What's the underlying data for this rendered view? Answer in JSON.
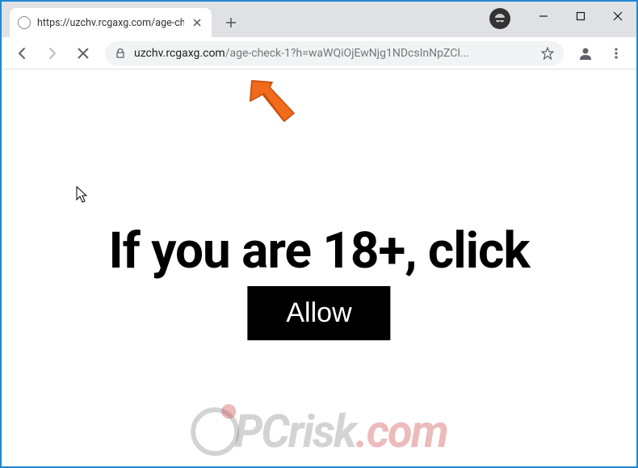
{
  "window": {
    "tab_title": "https://uzchv.rcgaxg.com/age-che",
    "url_domain": "uzchv.rcgaxg.com",
    "url_path": "/age-check-1?h=waWQiOjEwNjg1NDcsInNpZCI...",
    "colors": {
      "accent": "#1e88d4",
      "titlebar": "#dfe1e5",
      "arrow": "#f26a1b"
    }
  },
  "page": {
    "headline": "If you are 18+, click",
    "allow_label": "Allow"
  },
  "watermark": {
    "brand": "PCrisk",
    "tld": ".com"
  },
  "icons": {
    "back": "back-icon",
    "forward": "forward-icon",
    "stop": "stop-icon",
    "lock": "lock-icon",
    "star": "star-icon",
    "profile": "profile-icon",
    "menu": "menu-icon",
    "close_tab": "close-icon",
    "new_tab": "plus-icon",
    "minimize": "minimize-icon",
    "maximize": "maximize-icon",
    "close_win": "close-icon",
    "incognito": "incognito-icon"
  }
}
